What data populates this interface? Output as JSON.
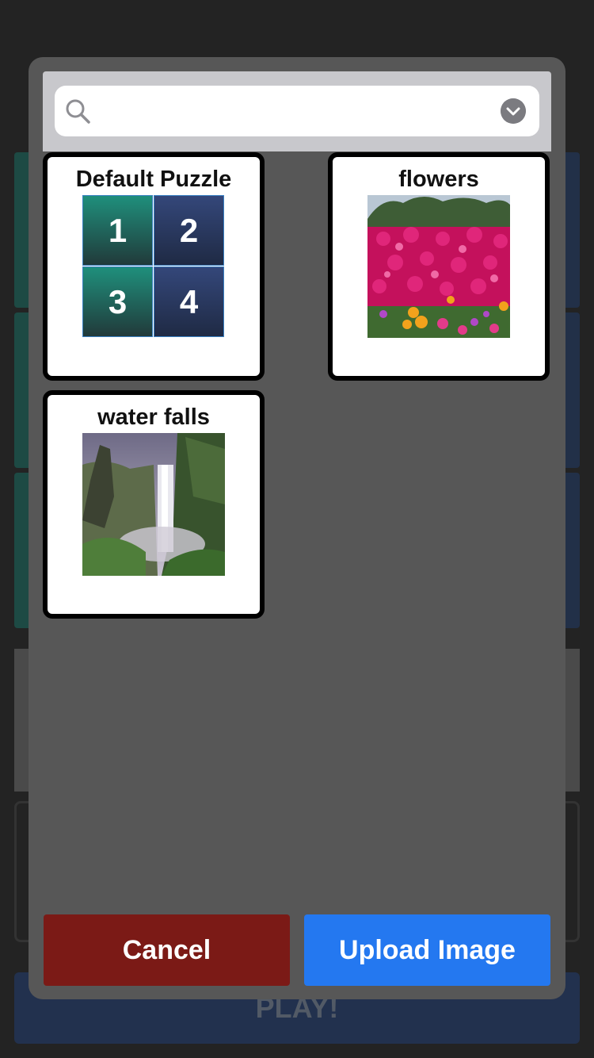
{
  "background": {
    "play_label": "PLAY!"
  },
  "search": {
    "value": "",
    "placeholder": ""
  },
  "puzzles": [
    {
      "title": "Default Puzzle",
      "tiles": [
        "1",
        "2",
        "3",
        "4"
      ]
    },
    {
      "title": "flowers"
    },
    {
      "title": "water falls"
    }
  ],
  "buttons": {
    "cancel": "Cancel",
    "upload": "Upload Image"
  },
  "colors": {
    "cancel": "#7b1a16",
    "upload": "#2478f0",
    "tile_green": "#1f8f7c",
    "tile_blue": "#34477a"
  }
}
